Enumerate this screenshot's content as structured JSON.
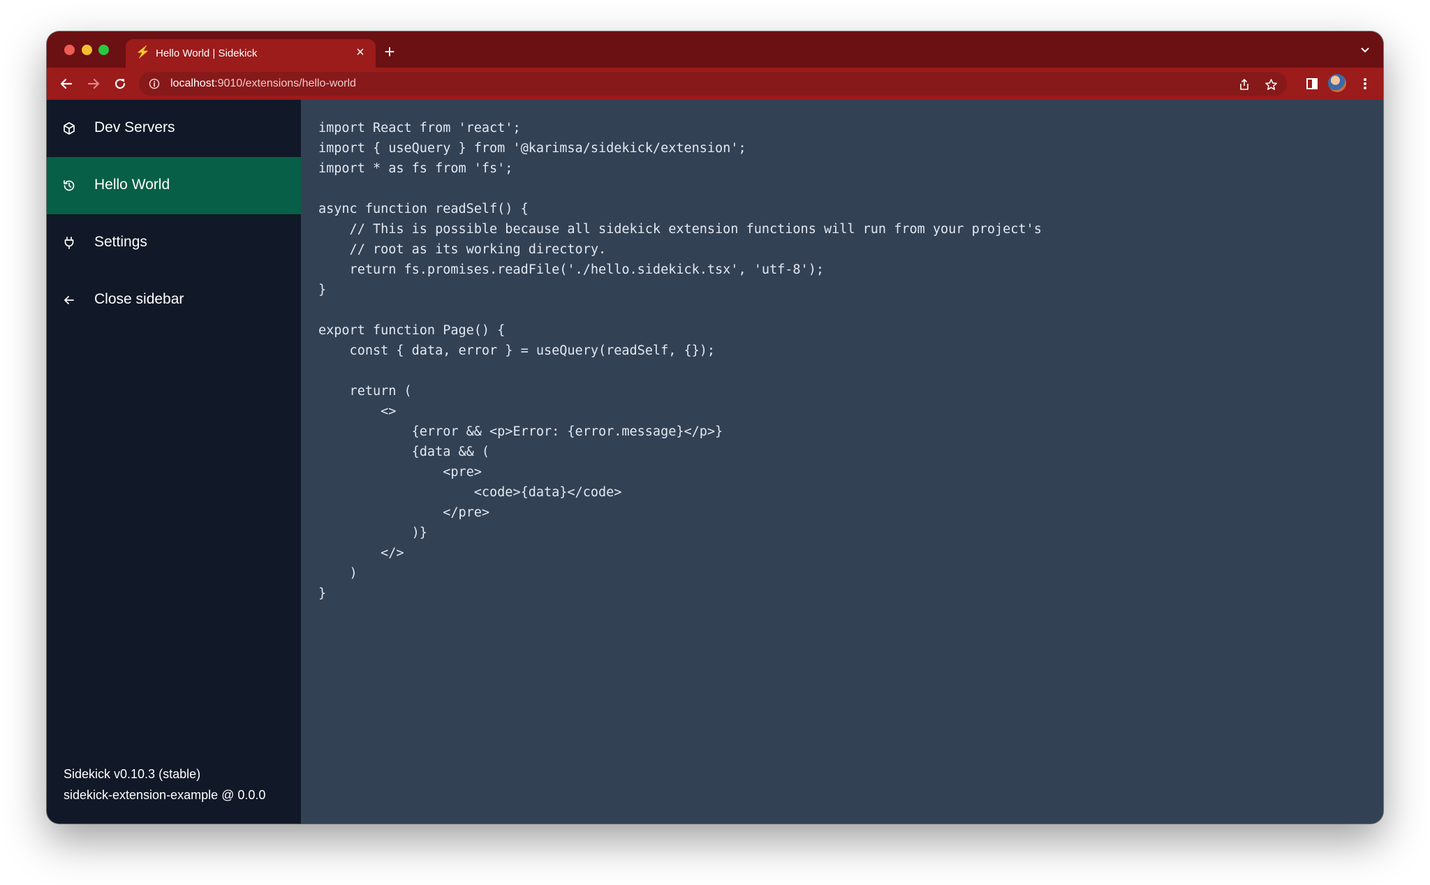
{
  "browser": {
    "tab_title": "Hello World | Sidekick",
    "tab_close": "×",
    "new_tab": "+",
    "url_host": "localhost",
    "url_path": ":9010/extensions/hello-world"
  },
  "sidebar": {
    "items": [
      {
        "label": "Dev Servers",
        "icon": "cube-icon"
      },
      {
        "label": "Hello World",
        "icon": "history-icon",
        "active": true
      },
      {
        "label": "Settings",
        "icon": "plug-icon"
      },
      {
        "label": "Close sidebar",
        "icon": "arrow-left-icon"
      }
    ],
    "version": "Sidekick v0.10.3 (stable)",
    "project": "sidekick-extension-example @ 0.0.0"
  },
  "code": "import React from 'react';\nimport { useQuery } from '@karimsa/sidekick/extension';\nimport * as fs from 'fs';\n\nasync function readSelf() {\n    // This is possible because all sidekick extension functions will run from your project's\n    // root as its working directory.\n    return fs.promises.readFile('./hello.sidekick.tsx', 'utf-8');\n}\n\nexport function Page() {\n    const { data, error } = useQuery(readSelf, {});\n\n    return (\n        <>\n            {error && <p>Error: {error.message}</p>}\n            {data && (\n                <pre>\n                    <code>{data}</code>\n                </pre>\n            )}\n        </>\n    )\n}",
  "colors": {
    "tabstrip": "#6b1013",
    "toolbar": "#9c1b1b",
    "sidebar": "#111827",
    "active_item": "#065f46",
    "content": "#334155"
  }
}
